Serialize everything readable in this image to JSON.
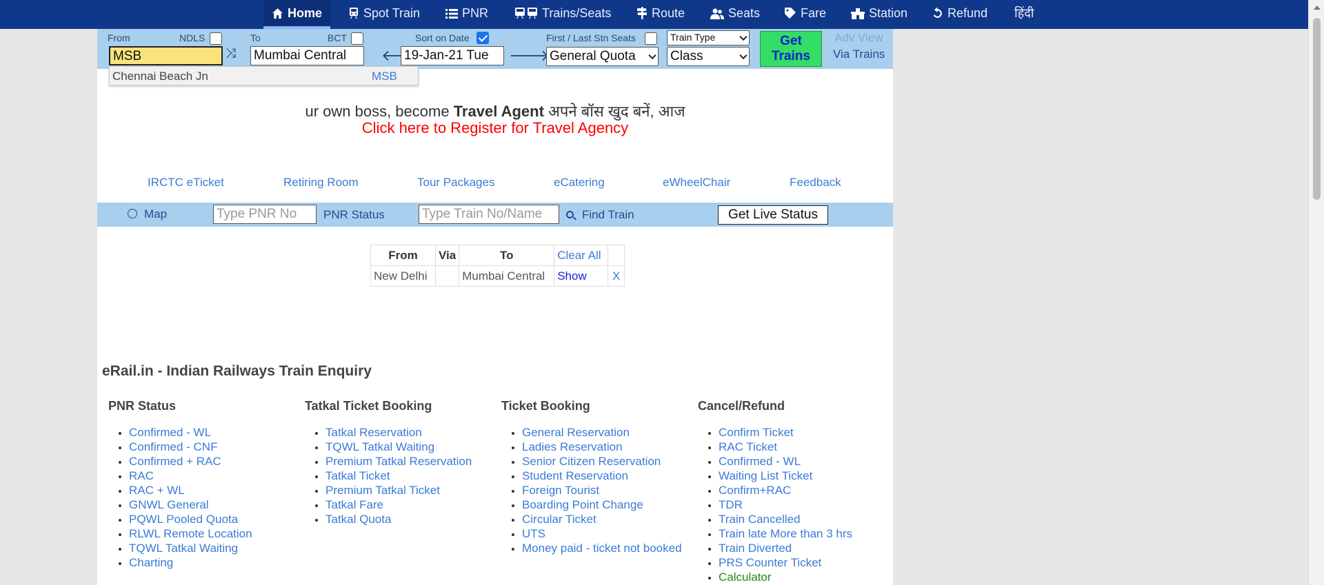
{
  "nav": {
    "items": [
      {
        "label": "Home",
        "icon": "home-icon"
      },
      {
        "label": "Spot Train",
        "icon": "train-icon"
      },
      {
        "label": "PNR",
        "icon": "list-icon"
      },
      {
        "label": "Trains/Seats",
        "icon": "trains-icon"
      },
      {
        "label": "Route",
        "icon": "signpost-icon"
      },
      {
        "label": "Seats",
        "icon": "users-icon"
      },
      {
        "label": "Fare",
        "icon": "ticket-icon"
      },
      {
        "label": "Station",
        "icon": "station-icon"
      },
      {
        "label": "Refund",
        "icon": "undo-icon"
      },
      {
        "label": "हिंदी",
        "icon": ""
      }
    ]
  },
  "search": {
    "from_label": "From",
    "ndls_label": "NDLS",
    "ndls_checked": false,
    "to_label": "To",
    "bct_label": "BCT",
    "bct_checked": false,
    "sort_label": "Sort on Date",
    "sort_checked": true,
    "first_last_label": "First / Last Stn Seats",
    "first_last_checked": false,
    "from_value": "MSB",
    "to_value": "Mumbai Central",
    "date_value": "19-Jan-21 Tue",
    "train_type": "Train Type",
    "quota": "General Quota",
    "class": "Class",
    "get_trains": "Get Trains",
    "adv_view": "Adv View",
    "via_trains": "Via Trains"
  },
  "autocomplete": {
    "name": "Chennai Beach Jn",
    "code": "MSB"
  },
  "banner": {
    "line1_prefix": "ur own boss, become ",
    "line1_bold": "Travel Agent",
    "line1_suffix": " अपने बॉस खुद बनें, आज",
    "line2": "Click here to Register for Travel Agency"
  },
  "quick_links": [
    "IRCTC eTicket",
    "Retiring Room",
    "Tour Packages",
    "eCatering",
    "eWheelChair",
    "Feedback"
  ],
  "live_bar": {
    "map": "Map",
    "pnr_placeholder": "Type PNR No",
    "pnr_status": "PNR Status",
    "train_placeholder": "Type Train No/Name",
    "find_train": "Find Train",
    "live_status": "Get Live Status"
  },
  "recent": {
    "headers": [
      "From",
      "Via",
      "To",
      "Clear All"
    ],
    "rows": [
      {
        "from": "New Delhi",
        "via": "",
        "to": "Mumbai Central",
        "show": "Show",
        "remove": "X"
      }
    ]
  },
  "site_title": "eRail.in - Indian Railways Train Enquiry",
  "columns": [
    {
      "title": "PNR Status",
      "items": [
        "Confirmed - WL",
        "Confirmed - CNF",
        "Confirmed + RAC",
        "RAC",
        "RAC + WL",
        "GNWL General",
        "PQWL Pooled Quota",
        "RLWL Remote Location",
        "TQWL Tatkal Waiting",
        "Charting"
      ]
    },
    {
      "title": "Tatkal Ticket Booking",
      "items": [
        "Tatkal Reservation",
        "TQWL Tatkal Waiting",
        "Premium Tatkal Reservation",
        "Tatkal Ticket",
        "Premium Tatkal Ticket",
        "Tatkal Fare",
        "Tatkal Quota"
      ]
    },
    {
      "title": "Ticket Booking",
      "items": [
        "General Reservation",
        "Ladies Reservation",
        "Senior Citizen Reservation",
        "Student Reservation",
        "Foreign Tourist",
        "Boarding Point Change",
        "Circular Ticket",
        "UTS",
        "Money paid - ticket not booked"
      ]
    },
    {
      "title": "Cancel/Refund",
      "items": [
        "Confirm Ticket",
        "RAC Ticket",
        "Confirmed - WL",
        "Waiting List Ticket",
        "Confirm+RAC",
        "TDR",
        "Train Cancelled",
        "Train late More than 3 hrs",
        "Train Diverted",
        "PRS Counter Ticket",
        "Calculator"
      ]
    }
  ],
  "colors": {
    "nav_bg": "#10388a",
    "link": "#3a7bd5",
    "bar_bg": "#a8cfee",
    "highlight_input": "#f8e47a",
    "get_trains_bg": "#33dd66",
    "calculator": "#1e8a1e"
  }
}
